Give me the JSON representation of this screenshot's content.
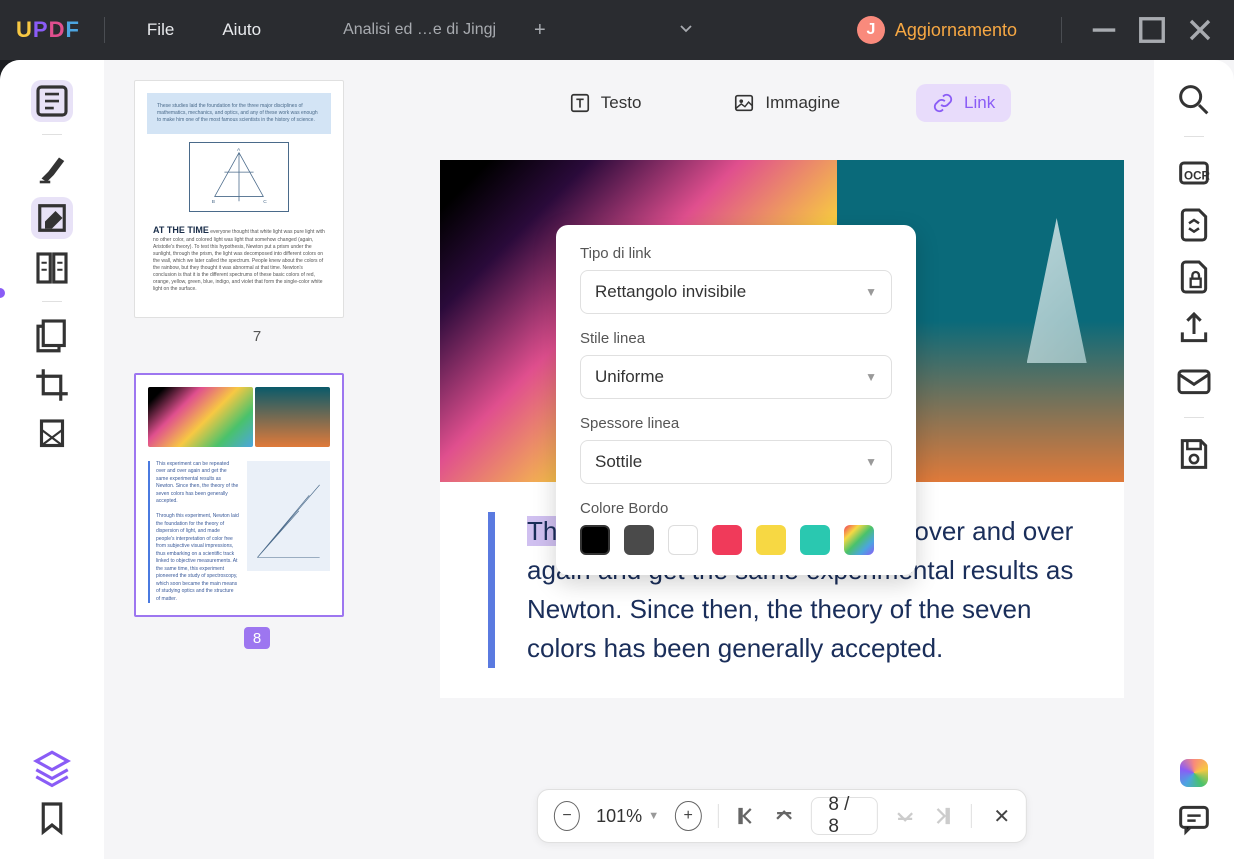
{
  "titlebar": {
    "logo": "UPDF",
    "file": "File",
    "help": "Aiuto",
    "tab": "Analisi ed …e di Jingj",
    "avatar_initial": "J",
    "update": "Aggiornamento"
  },
  "toolbar": {
    "text": "Testo",
    "image": "Immagine",
    "link": "Link"
  },
  "popup": {
    "link_type_label": "Tipo di link",
    "link_type_value": "Rettangolo invisibile",
    "line_style_label": "Stile linea",
    "line_style_value": "Uniforme",
    "line_weight_label": "Spessore linea",
    "line_weight_value": "Sottile",
    "border_color_label": "Colore Bordo",
    "colors": [
      "#000000",
      "#4a4a4a",
      "#ffffff",
      "#f03a5a",
      "#f7d843",
      "#2ac8b0",
      "rainbow"
    ]
  },
  "thumbnails": {
    "page7": {
      "label": "7",
      "top_text": "These studies laid the foundation for the three major disciplines of mathematics, mechanics, and optics, and any of these work was enough to make him one of the most famous scientists in the history of science.",
      "heading": "AT THE TIME",
      "body": "everyone thought that white light was pure light with no other color, and colored light was light that somehow changed (again, Aristotle's theory). To test this hypothesis, Newton put a prism under the sunlight, through the prism, the light was decomposed into different colors on the wall, which we later called the spectrum. People knew about the colors of the rainbow, but they thought it was abnormal at that time. Newton's conclusion is that it is the different spectrums of these basic colors of red, orange, yellow, green, blue, indigo, and violet that form the single-color white light on the surface."
    },
    "page8": {
      "label": "8",
      "p1": "This experiment can be repeated over and over again and get the same experimental results as Newton. Since then, the theory of the seven colors has been generally accepted.",
      "p2": "Through this experiment, Newton laid the foundation for the theory of dispersion of light, and made people's interpretation of color free from subjective visual impressions, thus embarking on a scientific track linked to objective measurements. At the same time, this experiment pioneered the study of spectroscopy, which soon became the main means of studying optics and the structure of matter."
    }
  },
  "document": {
    "highlighted_text": "This experiment can be repeated",
    "link_url": "https://updf.com/creare-pdf/edit-images-pdf/",
    "body_text": "over and over again and get the same experimental results as Newton. Since then, the theory of the seven colors has been generally accepted."
  },
  "bottom": {
    "zoom": "101%",
    "page": "8 / 8"
  }
}
